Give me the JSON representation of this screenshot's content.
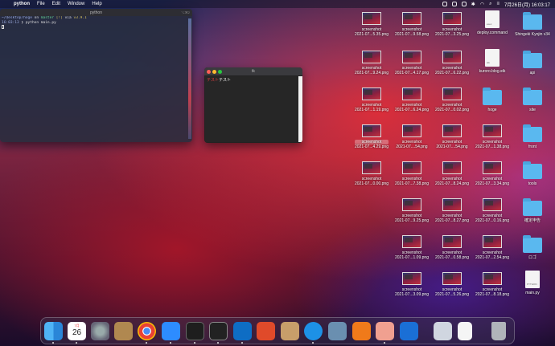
{
  "menubar": {
    "app": "python",
    "items": [
      "File",
      "Edit",
      "Window",
      "Help"
    ],
    "clock": "7月26日(月) 16:03:17"
  },
  "terminal": {
    "title": "python",
    "shortcut": "⌥⌘2",
    "line1_path": "~/desktop/hoge",
    "line1_on": "on",
    "line1_branch": "master",
    "line1_flags": "[!]",
    "line1_via": "via",
    "line1_ver": "v3.9.1",
    "line2_time": "16:03:13",
    "line2_cmd": "python main.py"
  },
  "tk": {
    "title": "tk",
    "text_sel": "テスト",
    "text_rest": "テスト"
  },
  "desktop": {
    "screenshots": [
      {
        "l1": "screenshot",
        "l2": "2021-07...5.35.png"
      },
      {
        "l1": "screenshot",
        "l2": "2021-07...9.58.png"
      },
      {
        "l1": "screenshot",
        "l2": "2021-07...3.25.png"
      },
      {
        "l1": "screenshot",
        "l2": "2021-07...9.24.png"
      },
      {
        "l1": "screenshot",
        "l2": "2021-07...4.17.png"
      },
      {
        "l1": "screenshot",
        "l2": "2021-07...6.22.png"
      },
      {
        "l1": "screenshot",
        "l2": "2021-07...1.19.png"
      },
      {
        "l1": "screenshot",
        "l2": "2021-07...6.24.png"
      },
      {
        "l1": "screenshot",
        "l2": "2021-07...0.02.png"
      },
      {
        "l1": "screenshot",
        "l2": "2021-07...4.29.png"
      },
      {
        "l1": "screenshot",
        "l2": "2021-07....54.png"
      },
      {
        "l1": "screenshot",
        "l2": "2021-07....54.png"
      },
      {
        "l1": "screenshot",
        "l2": "2021-07...1.38.png"
      },
      {
        "l1": "screenshot",
        "l2": "2021-07...0.00.png"
      },
      {
        "l1": "screenshot",
        "l2": "2021-07...7.38.png"
      },
      {
        "l1": "screenshot",
        "l2": "2021-07...8.24.png"
      },
      {
        "l1": "screenshot",
        "l2": "2021-07...3.34.png"
      },
      {
        "l1": "screenshot",
        "l2": "2021-07...9.25.png"
      },
      {
        "l1": "screenshot",
        "l2": "2021-07...8.27.png"
      },
      {
        "l1": "screenshot",
        "l2": "2021-07...0.16.png"
      },
      {
        "l1": "screenshot",
        "l2": "2021-07...1.09.png"
      },
      {
        "l1": "screenshot",
        "l2": "2021-07...0.58.png"
      },
      {
        "l1": "screenshot",
        "l2": "2021-07...2.54.png"
      },
      {
        "l1": "screenshot",
        "l2": "2021-07...3.09.png"
      },
      {
        "l1": "screenshot",
        "l2": "2021-07...5.26.png"
      },
      {
        "l1": "screenshot",
        "l2": "2021-07...8.18.png"
      }
    ],
    "files": [
      {
        "label": "deploy.command",
        "type": "doc",
        "tag": "exec"
      },
      {
        "label": "Shingeki Kyojin v34",
        "type": "folder"
      },
      {
        "label": "kuroro.blog.stk",
        "type": "doc",
        "tag": "stk"
      },
      {
        "label": "api",
        "type": "folder"
      },
      {
        "label": "hoge",
        "type": "folder"
      },
      {
        "label": "site",
        "type": "folder"
      },
      {
        "label": "front",
        "type": "folder"
      },
      {
        "label": "tools",
        "type": "folder"
      },
      {
        "label": "確定申告",
        "type": "folder"
      },
      {
        "label": "ロゴ",
        "type": "folder"
      },
      {
        "label": "main.py",
        "type": "doc",
        "tag": "PYTHON"
      }
    ]
  },
  "dock": {
    "calendar_month": "7月",
    "calendar_day": "26",
    "apps": [
      "finder",
      "calendar",
      "system-preferences",
      "archive-utility",
      "chrome",
      "zoom",
      "terminal",
      "terminal2",
      "vscode",
      "activity",
      "tool",
      "docker",
      "disk-utility",
      "sourcetree",
      "preview",
      "vpn",
      "screenshot-stack",
      "document-stack",
      "trash"
    ]
  }
}
